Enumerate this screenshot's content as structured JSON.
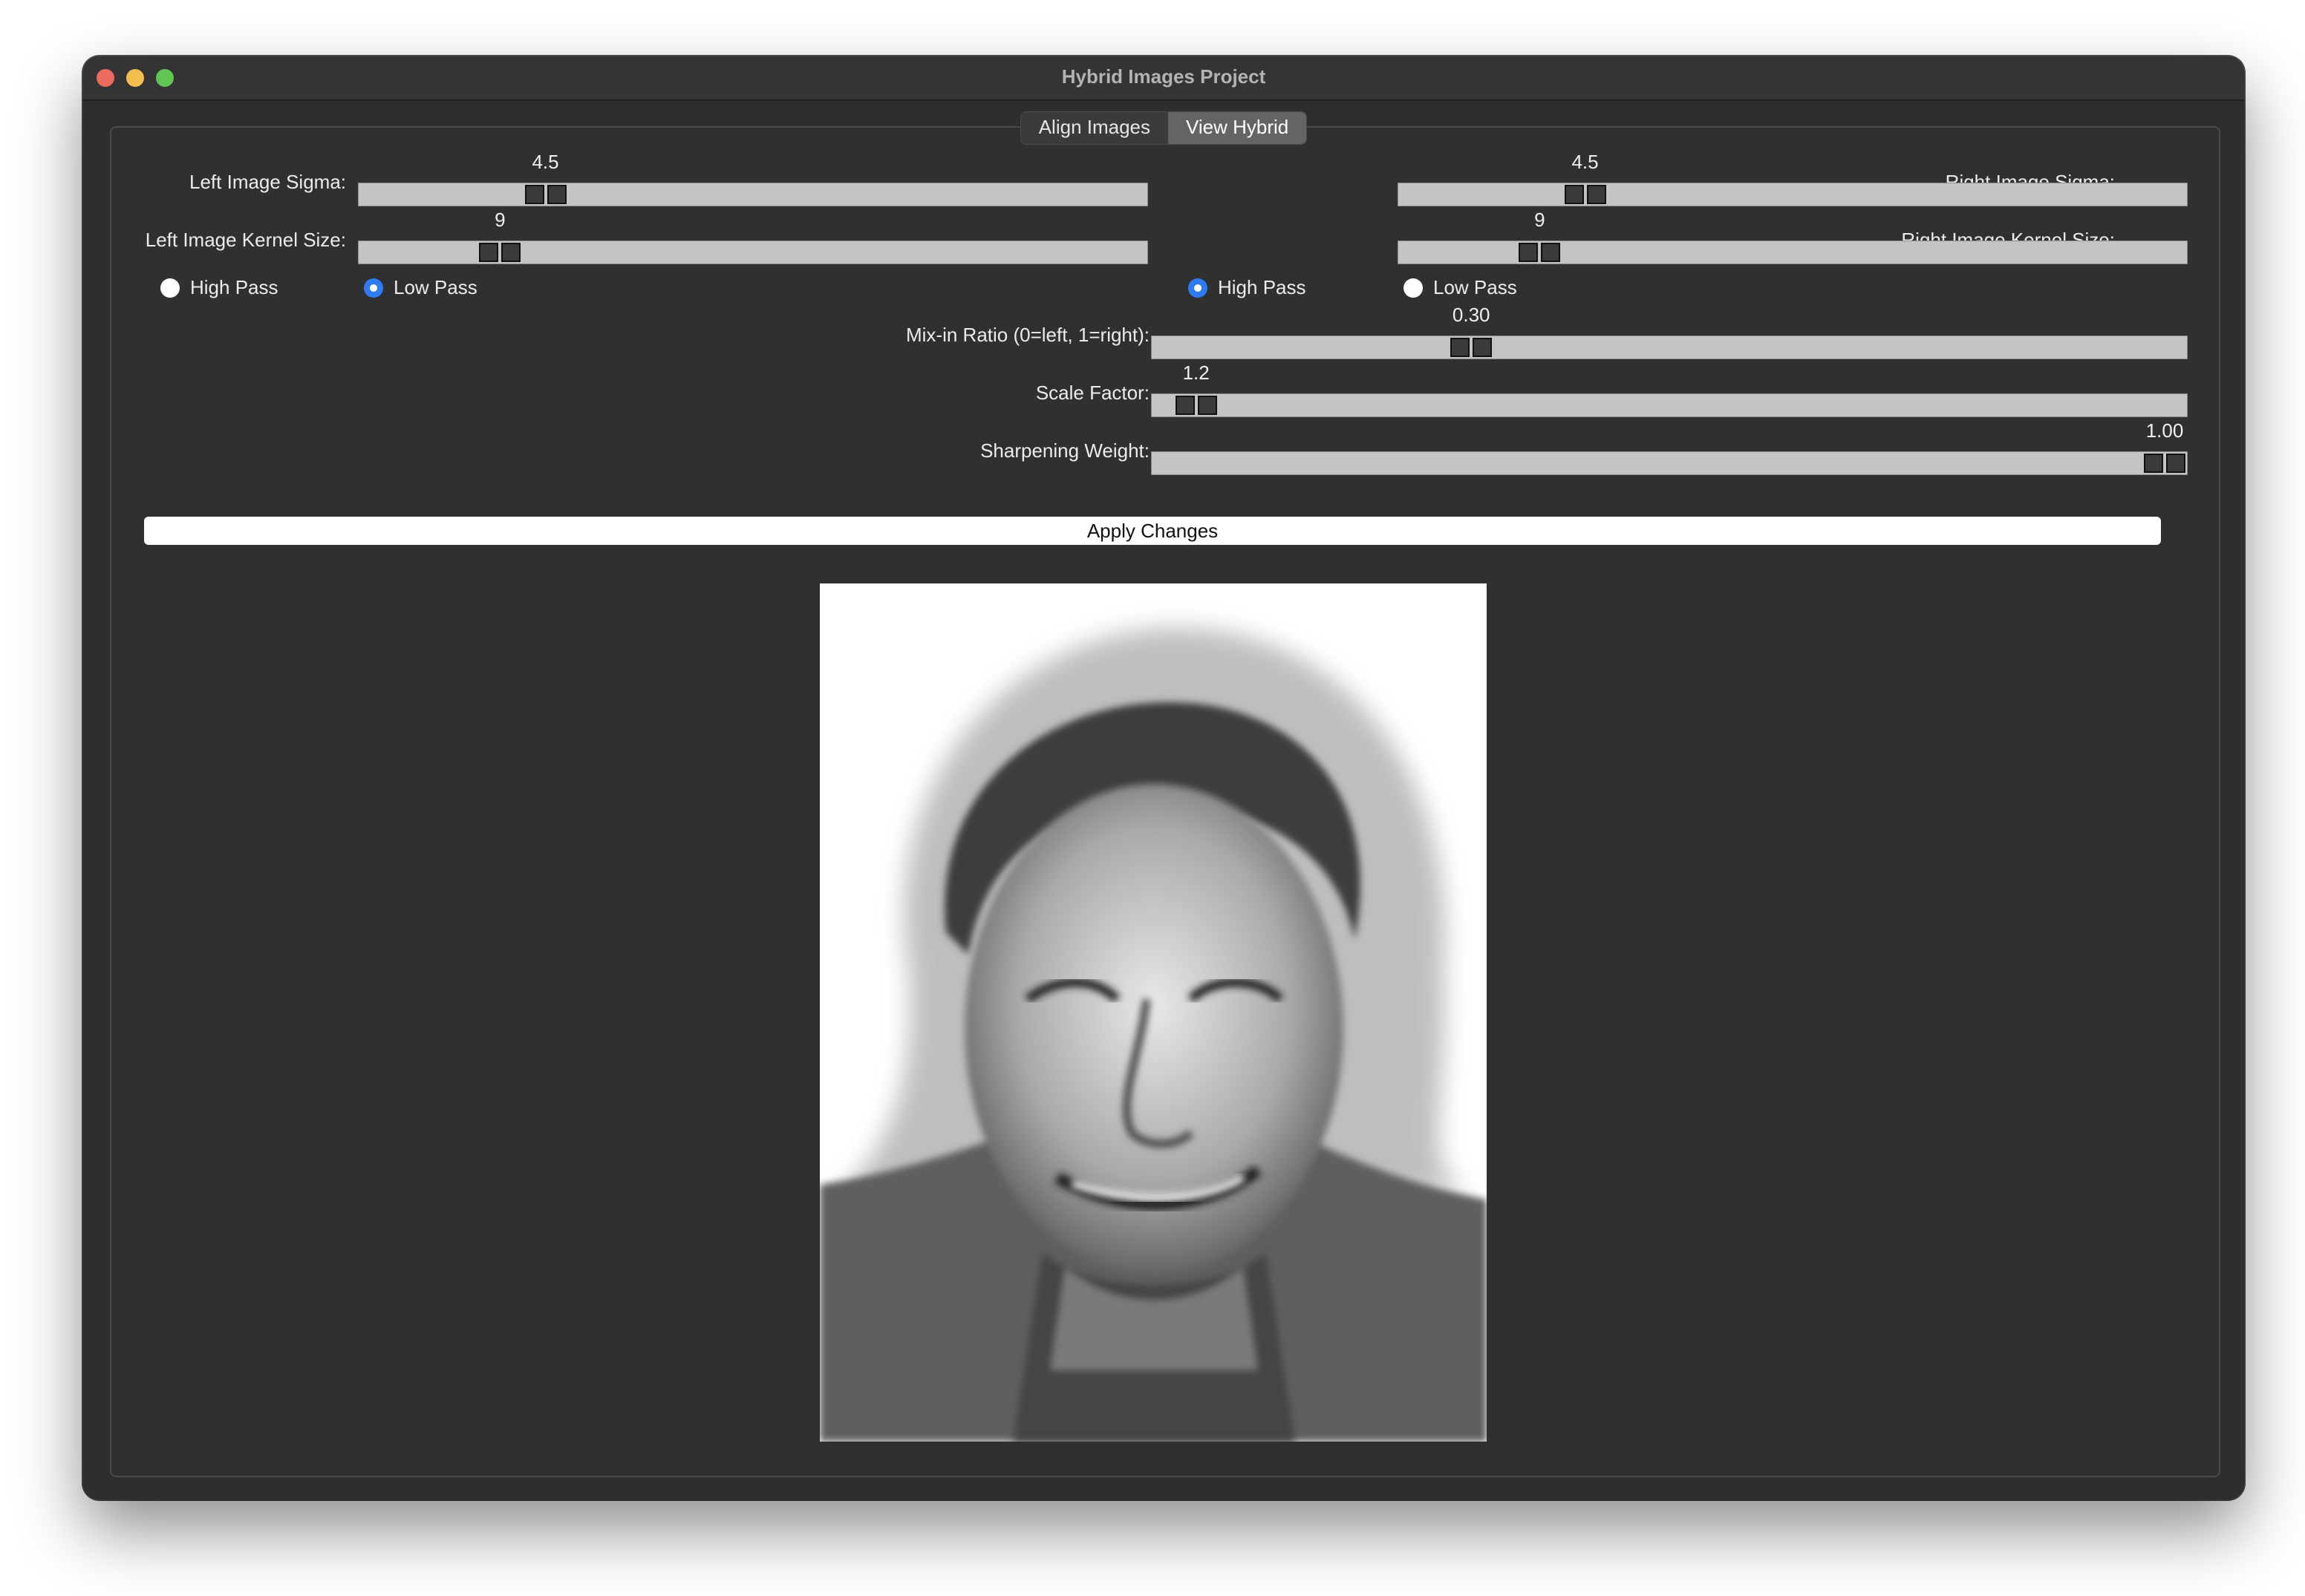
{
  "window": {
    "title": "Hybrid Images Project"
  },
  "tabs": [
    {
      "label": "Align Images",
      "active": false
    },
    {
      "label": "View Hybrid",
      "active": true
    }
  ],
  "left": {
    "sigma": {
      "label": "Left Image Sigma:",
      "value": "4.5",
      "min": 0.1,
      "max": 20
    },
    "kernel": {
      "label": "Left Image Kernel Size:",
      "value": "9",
      "min": 1,
      "max": 51
    },
    "filters": [
      {
        "label": "High Pass",
        "selected": false
      },
      {
        "label": "Low Pass",
        "selected": true
      }
    ]
  },
  "right": {
    "sigma": {
      "label": "Right Image Sigma:",
      "value": "4.5",
      "min": 0.1,
      "max": 20
    },
    "kernel": {
      "label": "Right Image Kernel Size:",
      "value": "9",
      "min": 1,
      "max": 51
    },
    "filters": [
      {
        "label": "High Pass",
        "selected": true
      },
      {
        "label": "Low Pass",
        "selected": false
      }
    ]
  },
  "mix": {
    "label": "Mix-in Ratio (0=left, 1=right):",
    "value": "0.30",
    "min": 0,
    "max": 1
  },
  "scale": {
    "label": "Scale Factor:",
    "value": "1.2",
    "min": 1,
    "max": 10
  },
  "sharpen": {
    "label": "Sharpening Weight:",
    "value": "1.00",
    "min": 0,
    "max": 1
  },
  "apply_label": "Apply Changes",
  "colors": {
    "accent": "#2f7bf5",
    "window_bg": "#2e2e2e",
    "track": "#c4c4c4"
  }
}
